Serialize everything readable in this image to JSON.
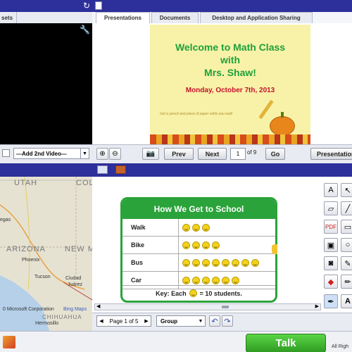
{
  "left_top": {
    "tab_label": "sets",
    "add_video_label": "---Add 2nd Video---"
  },
  "presentation": {
    "tabs": [
      "Presentations",
      "Documents",
      "Desktop and Application Sharing"
    ],
    "slide": {
      "line1": "Welcome to Math Class",
      "line2": "with",
      "line3": "Mrs. Shaw!",
      "date": "Monday, October 7th, 2013",
      "note": "Get a pencil and piece of paper while you wait!"
    },
    "controls": {
      "prev": "Prev",
      "next": "Next",
      "page": "1",
      "of": "of 9",
      "go": "Go",
      "presentation": "Presentation"
    }
  },
  "map": {
    "labels": {
      "utah": "UTAH",
      "col": "COL",
      "vegas": "egas",
      "arizona": "ARIZONA",
      "newm": "NEW M",
      "phoenix": "Phoenix",
      "tucson": "Tucson",
      "ciudad": "Ciudad",
      "juarez": "Juárez",
      "chihuahua": "CHIHUAHUA",
      "hermosillo": "Hermosillo"
    },
    "copyright": "0 Microsoft Corporation",
    "bing": "Bing Maps"
  },
  "whiteboard": {
    "chart_title": "How We Get to School",
    "rows": [
      {
        "label": "Walk",
        "count": 3
      },
      {
        "label": "Bike",
        "count": 4
      },
      {
        "label": "Bus",
        "count": 8
      },
      {
        "label": "Car",
        "count": 6
      }
    ],
    "key_prefix": "Key: Each",
    "key_suffix": "= 10 students.",
    "page_text": "Page 1 of 5",
    "group": "Group"
  },
  "footer": {
    "talk": "Talk",
    "rights": "All Righ"
  },
  "colors": {
    "title_bar": "#2d2f9a",
    "chart_green": "#2aa33a",
    "talk_green": "#3fbd2f",
    "slide_bg": "#f8f2a8"
  }
}
